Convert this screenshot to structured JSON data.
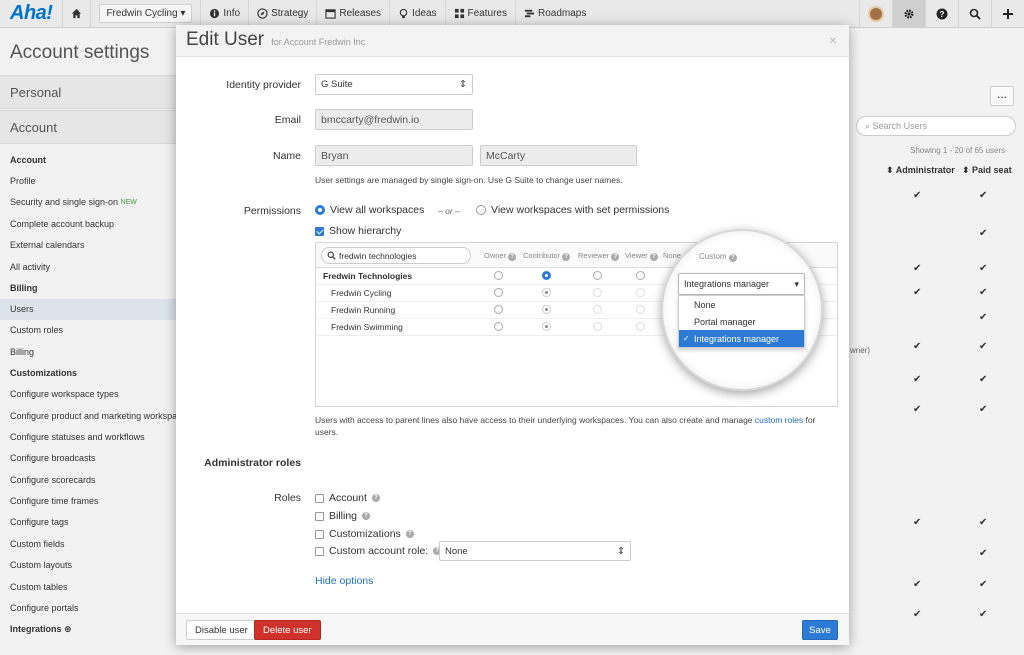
{
  "nav": {
    "logo": "Aha!",
    "workspace": "Fredwin Cycling",
    "items": [
      "Info",
      "Strategy",
      "Releases",
      "Ideas",
      "Features",
      "Roadmaps"
    ]
  },
  "background": {
    "page_title": "Account settings",
    "personal_section": "Personal",
    "account_section": "Account",
    "sidebar": {
      "account_header": "Account",
      "account_items": [
        "Profile",
        "Security and single sign-on",
        "Complete account backup",
        "External calendars",
        "All activity"
      ],
      "new_badge": "NEW",
      "billing_header": "Billing",
      "billing_items": [
        "Users",
        "Custom roles",
        "Billing"
      ],
      "custom_header": "Customizations",
      "custom_items": [
        "Configure workspace types",
        "Configure product and marketing workspaces",
        "Configure statuses and workflows",
        "Configure broadcasts",
        "Configure scorecards",
        "Configure time frames",
        "Configure tags",
        "Custom fields",
        "Custom layouts",
        "Custom tables",
        "Configure portals"
      ],
      "integrations_header": "Integrations"
    },
    "right": {
      "dots": "...",
      "search_placeholder": "Search Users",
      "count": "Showing 1 - 20 of 65 users",
      "col_admin": "Administrator",
      "col_paid": "Paid seat",
      "owner_fragment": "wner)"
    }
  },
  "modal": {
    "title": "Edit User",
    "subtitle": "for Account Fredwin Inc",
    "close": "×",
    "identity_label": "Identity provider",
    "identity_value": "G Suite",
    "email_label": "Email",
    "email_value": "bmccarty@fredwin.io",
    "name_label": "Name",
    "first_name": "Bryan",
    "last_name": "McCarty",
    "sso_help": "User settings are managed by single sign-on. Use G Suite to change user names.",
    "permissions_label": "Permissions",
    "view_all": "View all workspaces",
    "or": "– or –",
    "view_set": "View workspaces with set permissions",
    "show_hierarchy": "Show hierarchy",
    "table": {
      "search_value": "fredwin technologies",
      "columns": [
        "Owner",
        "Contributor",
        "Reviewer",
        "Viewer",
        "None",
        "Custom"
      ],
      "rows": [
        "Fredwin Technologies",
        "Fredwin Cycling",
        "Fredwin Running",
        "Fredwin Swimming"
      ]
    },
    "custom_select": {
      "selected": "Integrations manager",
      "options": [
        "None",
        "Portal manager",
        "Integrations manager"
      ]
    },
    "parent_help_1": "Users with access to parent lines also have access to their underlying workspaces. You can also create and manage",
    "parent_help_link": "custom roles",
    "parent_help_2": "for users.",
    "admin_roles_heading": "Administrator roles",
    "roles_label": "Roles",
    "roles": [
      "Account",
      "Billing",
      "Customizations"
    ],
    "custom_account_role": "Custom account role:",
    "custom_account_value": "None",
    "hide_options": "Hide options",
    "btn_disable": "Disable user",
    "btn_delete": "Delete user",
    "btn_save": "Save"
  },
  "colors": {
    "accent": "#2e7bd6",
    "danger": "#d0322b",
    "logo": "#0073cf"
  }
}
